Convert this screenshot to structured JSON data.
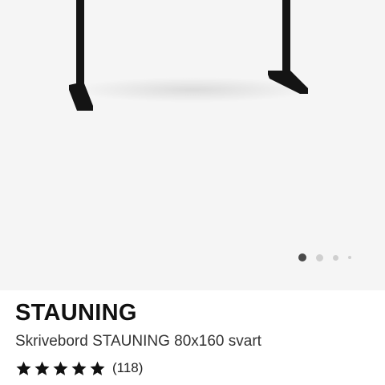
{
  "product": {
    "name": "STAUNING",
    "description": "Skrivebord STAUNING 80x160 svart",
    "rating": {
      "stars": 5,
      "max_stars": 5,
      "review_count_label": "(118)"
    }
  },
  "gallery": {
    "image_count": 4,
    "active_index": 0,
    "active_dot_color": "#4a4a4a",
    "inactive_dot_color": "#cfcfcf"
  },
  "icons": {
    "star": "star-icon"
  }
}
